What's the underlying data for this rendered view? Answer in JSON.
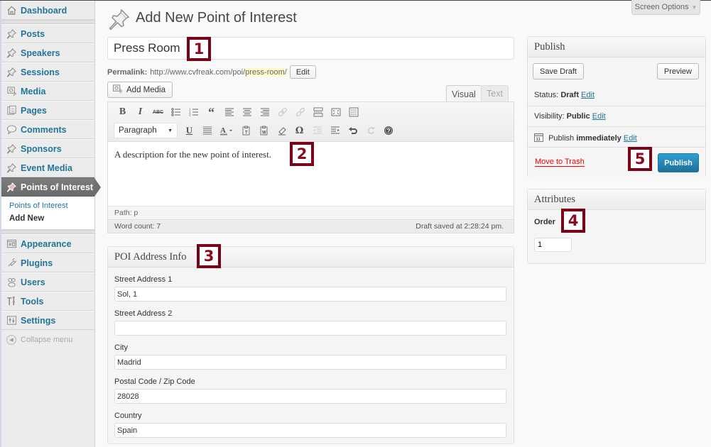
{
  "sidebar": {
    "items": [
      {
        "label": "Dashboard",
        "icon": "home-icon"
      },
      {
        "label": "Posts",
        "icon": "pushpin-icon"
      },
      {
        "label": "Speakers",
        "icon": "pushpin-icon"
      },
      {
        "label": "Sessions",
        "icon": "pushpin-icon"
      },
      {
        "label": "Media",
        "icon": "media-icon"
      },
      {
        "label": "Pages",
        "icon": "pages-icon"
      },
      {
        "label": "Comments",
        "icon": "comment-bubble-icon"
      },
      {
        "label": "Sponsors",
        "icon": "pushpin-icon"
      },
      {
        "label": "Event Media",
        "icon": "pushpin-icon"
      },
      {
        "label": "Points of Interest",
        "icon": "pushpin-icon",
        "current": true
      }
    ],
    "submenu": [
      {
        "label": "Points of Interest"
      },
      {
        "label": "Add New",
        "active": true
      }
    ],
    "items_bottom": [
      {
        "label": "Appearance",
        "icon": "appearance-icon"
      },
      {
        "label": "Plugins",
        "icon": "plugin-plug-icon"
      },
      {
        "label": "Users",
        "icon": "users-icon"
      },
      {
        "label": "Tools",
        "icon": "tools-icon"
      },
      {
        "label": "Settings",
        "icon": "settings-icon"
      }
    ],
    "collapse_label": "Collapse menu"
  },
  "header": {
    "title": "Add New Point of Interest",
    "screen_options": "Screen Options"
  },
  "post": {
    "title_value": "Press Room",
    "permalink_label": "Permalink:",
    "permalink_base": "http://www.cvfreak.com/poi/",
    "permalink_slug": "press-room",
    "permalink_trail": "/",
    "permalink_edit": "Edit",
    "add_media": "Add Media"
  },
  "editor": {
    "tabs": [
      {
        "label": "Visual",
        "active": true
      },
      {
        "label": "Text"
      }
    ],
    "format_select": "Paragraph",
    "content": "A description for the new point of interest.",
    "path": "Path: p",
    "word_count": "Word count: 7",
    "draft_saved": "Draft saved at 2:28:24 pm.",
    "toolbar_row1": [
      "bold",
      "italic",
      "strikethrough",
      "bullet-list",
      "numbered-list",
      "blockquote",
      "align-left",
      "align-center",
      "align-right",
      "insert-link",
      "unlink",
      "insert-more",
      "fullscreen",
      "toolbar-toggle"
    ],
    "toolbar_row2": [
      "underline",
      "justify",
      "text-color",
      "paste-as-text",
      "paste-from-word",
      "clear-formatting",
      "special-character",
      "outdent",
      "indent",
      "undo",
      "redo",
      "help"
    ]
  },
  "address_box": {
    "title": "POI Address Info",
    "fields": [
      {
        "label": "Street Address 1",
        "value": "Sol, 1"
      },
      {
        "label": "Street Address 2",
        "value": ""
      },
      {
        "label": "City",
        "value": "Madrid"
      },
      {
        "label": "Postal Code / Zip Code",
        "value": "28028"
      },
      {
        "label": "Country",
        "value": "Spain"
      }
    ]
  },
  "publish_box": {
    "title": "Publish",
    "save_draft": "Save Draft",
    "preview": "Preview",
    "status_label": "Status:",
    "status_value": "Draft",
    "visibility_label": "Visibility:",
    "visibility_value": "Public",
    "schedule_label": "Publish",
    "schedule_value": "immediately",
    "edit_link": "Edit",
    "move_to_trash": "Move to Trash",
    "publish": "Publish"
  },
  "attributes_box": {
    "title": "Attributes",
    "order_label": "Order",
    "order_value": "1"
  },
  "annotations": [
    "1",
    "2",
    "3",
    "4",
    "5"
  ],
  "colors": {
    "link": "#21759b",
    "annotation": "#7a0016",
    "publish_button": "#2a95c5",
    "trash": "#ff0000",
    "current_menu": "#6f6f6f"
  }
}
